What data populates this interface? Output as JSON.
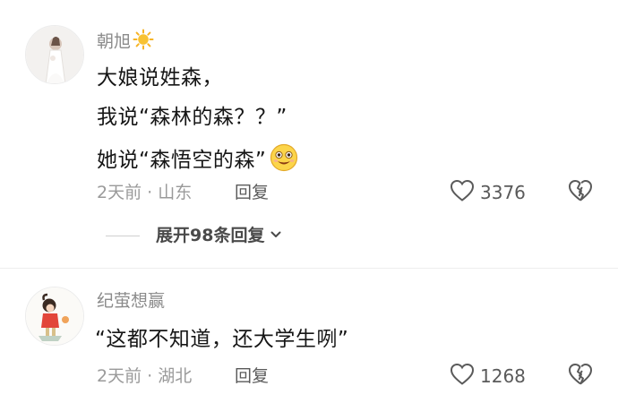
{
  "comments": [
    {
      "username": "朝旭",
      "username_emoji": "sun-emoji",
      "lines": [
        "大娘说姓森，",
        "我说“森林的森？？”",
        "她说“森悟空的森”"
      ],
      "line_emoji": "grinning-face-emoji",
      "meta": "2天前 · 山东",
      "reply_label": "回复",
      "like_count": "3376",
      "expand_label": "展开98条回复"
    },
    {
      "username": "纪萤想赢",
      "lines": [
        "“这都不知道，还大学生咧”"
      ],
      "meta": "2天前 · 湖北",
      "reply_label": "回复",
      "like_count": "1268"
    }
  ],
  "colors": {
    "username": "#8b8b8b",
    "text": "#161616",
    "meta": "#9a9a9a",
    "sun": "#f6b324"
  }
}
